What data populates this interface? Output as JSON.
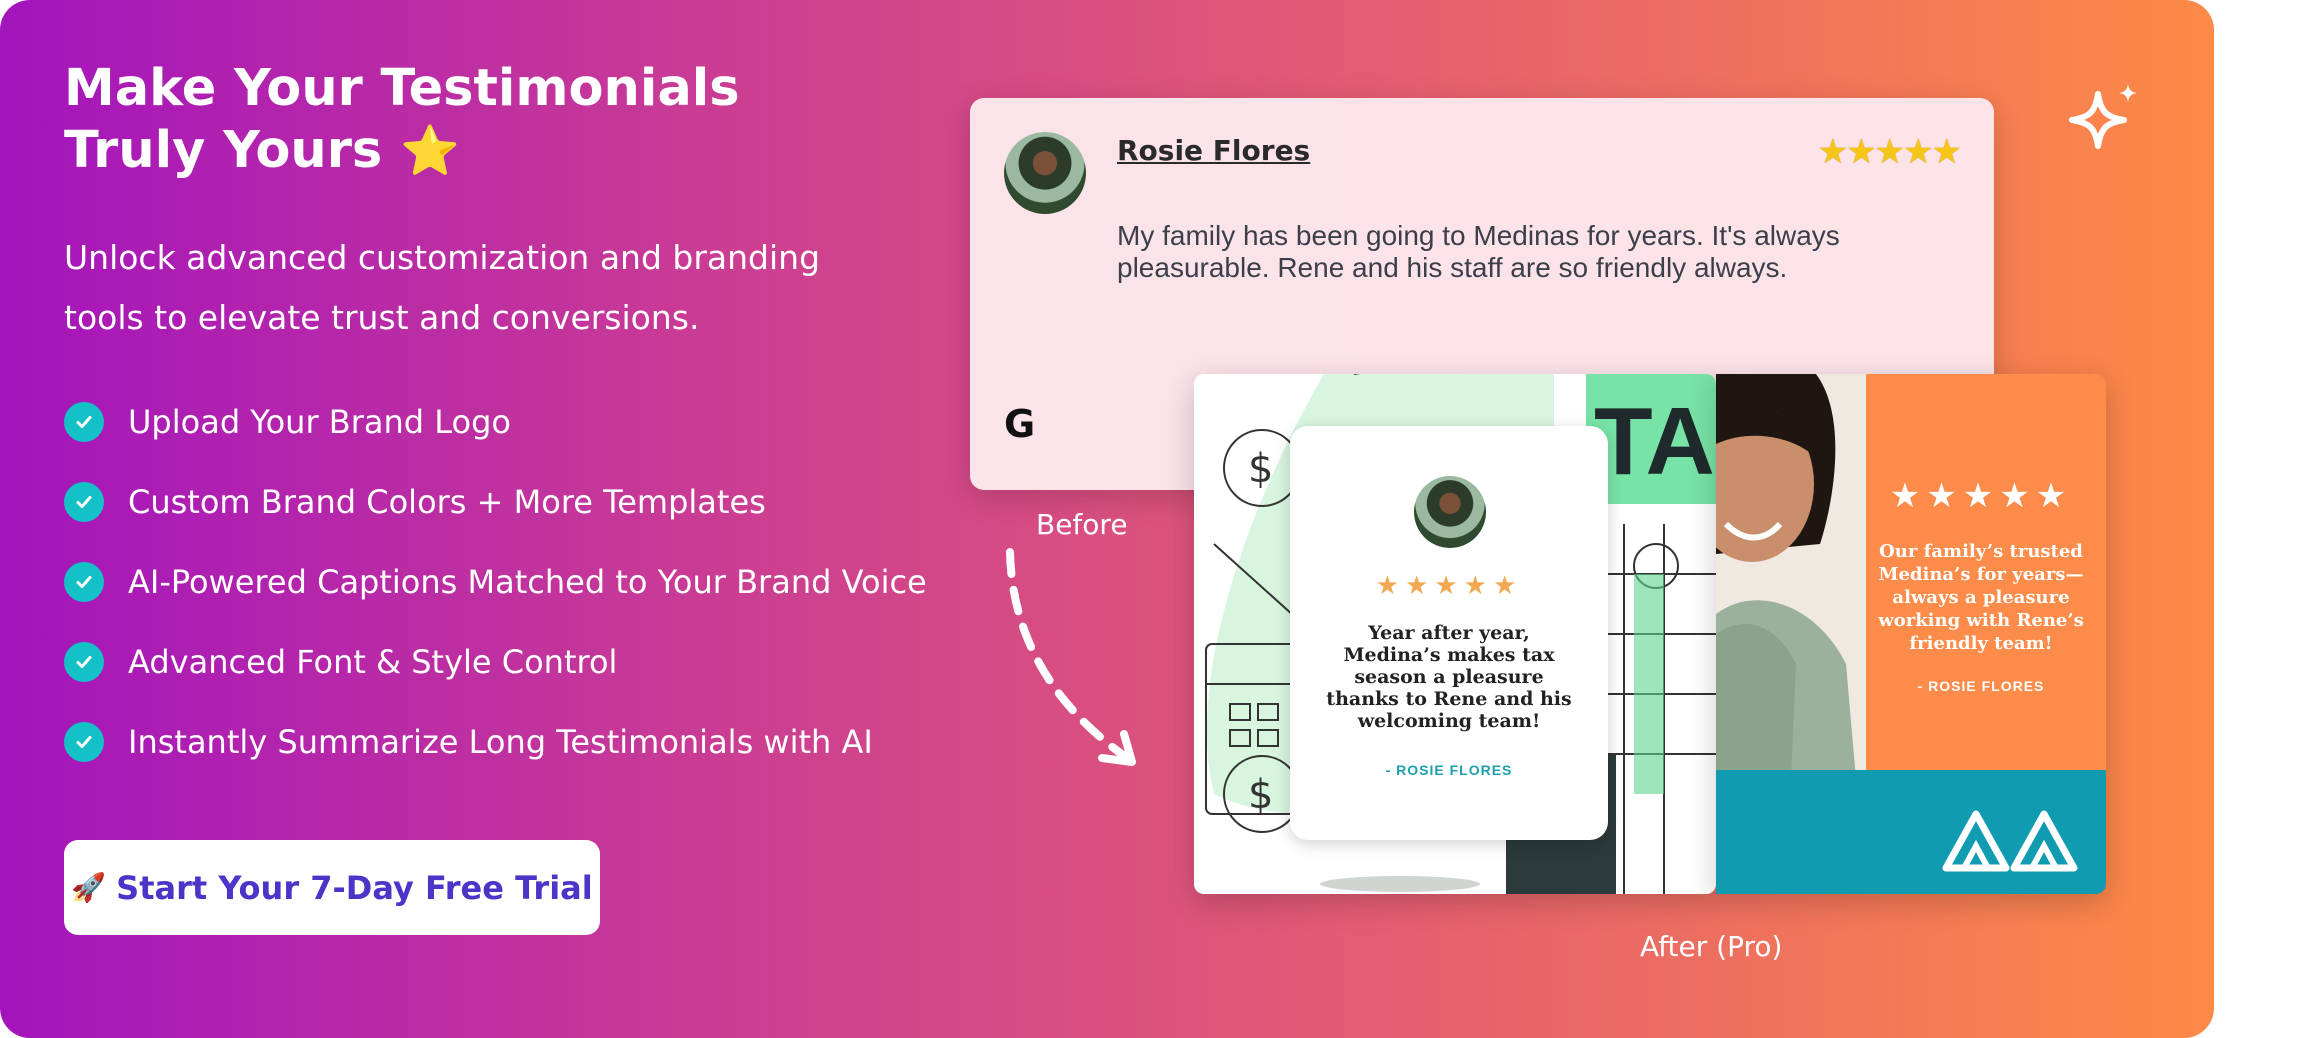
{
  "hero": {
    "title_line1": "Make Your Testimonials",
    "title_line2": "Truly Yours",
    "title_emoji": "⭐",
    "subtitle_line1": "Unlock advanced customization and branding",
    "subtitle_line2": "tools to elevate trust and conversions."
  },
  "features": [
    "Upload Your Brand Logo",
    "Custom Brand Colors + More Templates",
    "AI-Powered Captions Matched to Your Brand Voice",
    "Advanced Font & Style Control",
    "Instantly Summarize Long Testimonials with AI"
  ],
  "cta": {
    "icon": "🚀",
    "label": "Start Your 7-Day Free Trial"
  },
  "before": {
    "reviewer": "Rosie Flores",
    "rating": "★★★★★",
    "text": "My family has been going to Medinas for years. It's always pleasurable. Rene and his staff are so friendly always.",
    "source_icon": "G",
    "label": "Before"
  },
  "after": {
    "label": "After (Pro)",
    "card1": {
      "stars": "★★★★★",
      "quote": "Year after year, Medina’s makes tax season a pleasure thanks to Rene and his welcoming team!",
      "author": "- ROSIE FLORES",
      "tax_text": "TAX"
    },
    "card2": {
      "stars": "★★★★★",
      "quote": "Our family’s trusted Medina’s for years—always a pleasure working with Rene’s friendly team!",
      "author": "- ROSIE FLORES"
    }
  },
  "colors": {
    "gradient_start": "#a314bd",
    "gradient_end": "#fd8a46",
    "check": "#13c2c7",
    "cta_text": "#4b35c9",
    "teal": "#119bb1",
    "orange": "#fd8c4a"
  }
}
